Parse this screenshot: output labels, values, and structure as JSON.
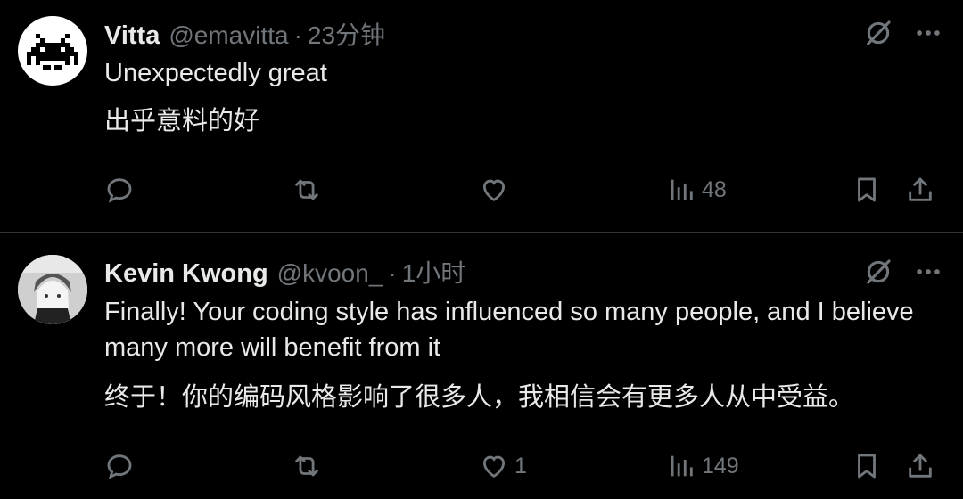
{
  "tweets": [
    {
      "name": "Vitta",
      "handle": "@emavitta",
      "separator": "·",
      "time": "23分钟",
      "text_en": "Unexpectedly great",
      "text_zh": "出乎意料的好",
      "likes": "",
      "views": "48"
    },
    {
      "name": "Kevin Kwong",
      "handle": "@kvoon_",
      "separator": "·",
      "time": "1小时",
      "text_en": "Finally! Your coding style has influenced so many people, and I believe many more will benefit from it",
      "text_zh": "终于！你的编码风格影响了很多人，我相信会有更多人从中受益。",
      "likes": "1",
      "views": "149"
    }
  ],
  "colors": {
    "background": "#000000",
    "text": "#e7e9ea",
    "muted": "#71767b",
    "divider": "#2f3336"
  },
  "icons": [
    "grok-icon",
    "more-icon",
    "reply-icon",
    "repost-icon",
    "like-icon",
    "views-icon",
    "bookmark-icon",
    "share-icon"
  ]
}
